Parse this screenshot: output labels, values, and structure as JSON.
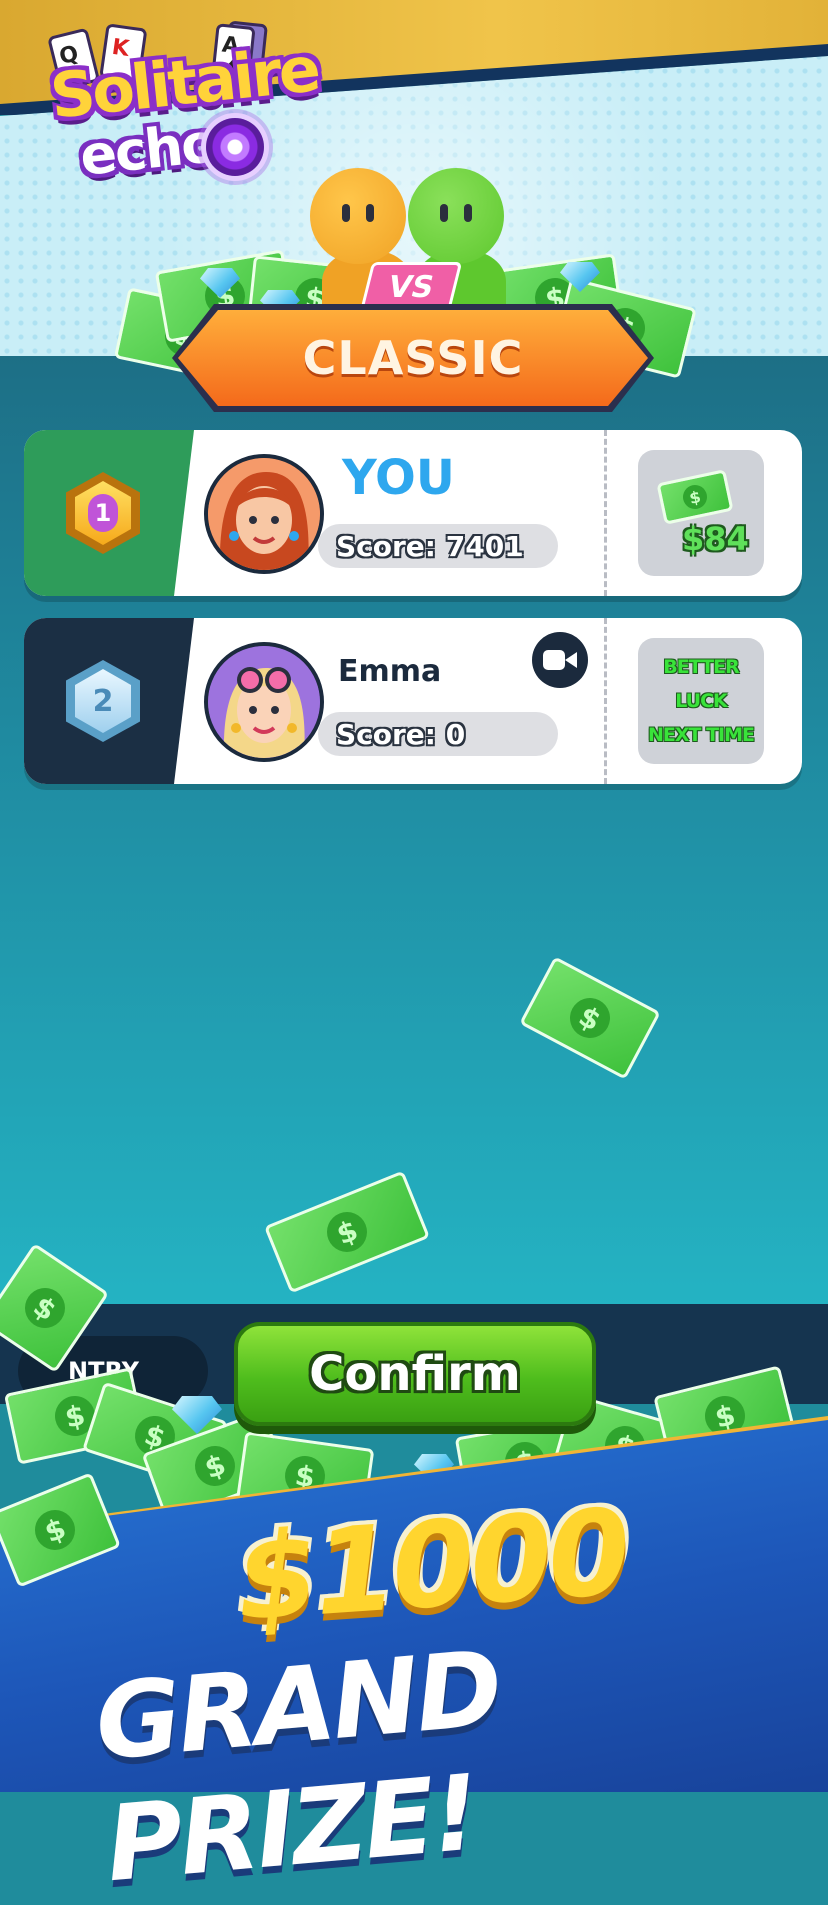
{
  "app": {
    "logo_line1": "Solitaire",
    "logo_line2": "echo"
  },
  "match": {
    "mode": "CLASSIC",
    "versus": "VS"
  },
  "players": [
    {
      "rank": "1",
      "name": "YOU",
      "score_text": "Score: 7401",
      "prize": "$84",
      "has_video": false
    },
    {
      "rank": "2",
      "name": "Emma",
      "score_text": "Score: 0",
      "result_line1": "BETTER LUCK",
      "result_line2": "NEXT TIME",
      "has_video": true
    }
  ],
  "bottom": {
    "entry_label": "NTRY",
    "confirm_label": "Confirm"
  },
  "promo": {
    "amount": "$1000",
    "subtitle": "GRAND PRIZE!"
  },
  "colors": {
    "rank1_panel": "#2e9c5a",
    "rank2_panel": "#1b2f44",
    "accent_blue": "#2ea7ee",
    "confirm_green": "#4fbd1d",
    "classic_orange": "#f46a1b"
  },
  "icons": {
    "bill": "$",
    "video": "video-camera-icon"
  }
}
